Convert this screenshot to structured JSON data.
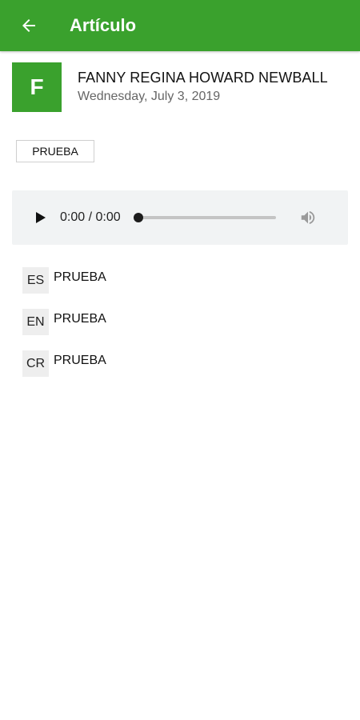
{
  "appbar": {
    "title": "Artículo",
    "back_icon": "arrow-left-icon",
    "color": "#3aa12d"
  },
  "author": {
    "initial": "F",
    "name": "FANNY REGINA HOWARD NEWBALL",
    "date": "Wednesday, July 3, 2019"
  },
  "tag": {
    "label": "PRUEBA"
  },
  "audio": {
    "time": "0:00 / 0:00",
    "progress": 0,
    "play_icon": "play-icon",
    "volume_icon": "volume-icon"
  },
  "translations": [
    {
      "lang": "ES",
      "text": "PRUEBA"
    },
    {
      "lang": "EN",
      "text": "PRUEBA"
    },
    {
      "lang": "CR",
      "text": "PRUEBA"
    }
  ]
}
